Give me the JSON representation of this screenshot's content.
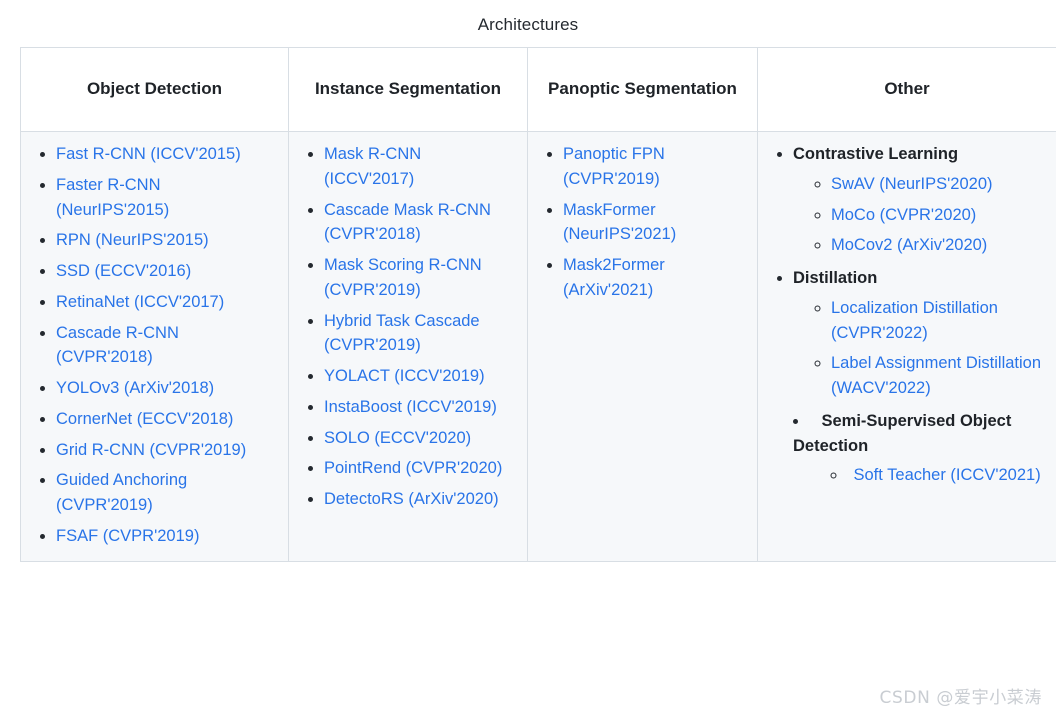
{
  "caption": "Architectures",
  "watermark": "CSDN @爱宇小菜涛",
  "colors": {
    "link": "#2974e8",
    "text": "#1f2328",
    "cell_bg": "#f6f8fa",
    "header_bg": "#ffffff",
    "border": "#d8dee4"
  },
  "columns": [
    {
      "header": "Object Detection"
    },
    {
      "header": "Instance Segmentation"
    },
    {
      "header": "Panoptic Segmentation"
    },
    {
      "header": "Other"
    }
  ],
  "object_detection": [
    "Fast R-CNN (ICCV'2015)",
    "Faster R-CNN (NeurIPS'2015)",
    "RPN (NeurIPS'2015)",
    "SSD (ECCV'2016)",
    "RetinaNet (ICCV'2017)",
    "Cascade R-CNN (CVPR'2018)",
    "YOLOv3 (ArXiv'2018)",
    "CornerNet (ECCV'2018)",
    "Grid R-CNN (CVPR'2019)",
    "Guided Anchoring (CVPR'2019)",
    "FSAF (CVPR'2019)"
  ],
  "instance_segmentation": [
    "Mask R-CNN (ICCV'2017)",
    "Cascade Mask R-CNN (CVPR'2018)",
    "Mask Scoring R-CNN (CVPR'2019)",
    "Hybrid Task Cascade (CVPR'2019)",
    "YOLACT (ICCV'2019)",
    "InstaBoost (ICCV'2019)",
    "SOLO (ECCV'2020)",
    "PointRend (CVPR'2020)",
    "DetectoRS (ArXiv'2020)"
  ],
  "panoptic_segmentation": [
    "Panoptic FPN (CVPR'2019)",
    "MaskFormer (NeurIPS'2021)",
    "Mask2Former (ArXiv'2021)"
  ],
  "other": [
    {
      "title": "Contrastive Learning",
      "items": [
        "SwAV (NeurIPS'2020)",
        "MoCo (CVPR'2020)",
        "MoCov2 (ArXiv'2020)"
      ]
    },
    {
      "title": "Distillation",
      "items": [
        "Localization Distillation (CVPR'2022)",
        "Label Assignment Distillation (WACV'2022)"
      ]
    },
    {
      "title": "Semi-Supervised Object Detection",
      "outdent": true,
      "items": [
        "Soft Teacher (ICCV'2021)"
      ]
    }
  ]
}
